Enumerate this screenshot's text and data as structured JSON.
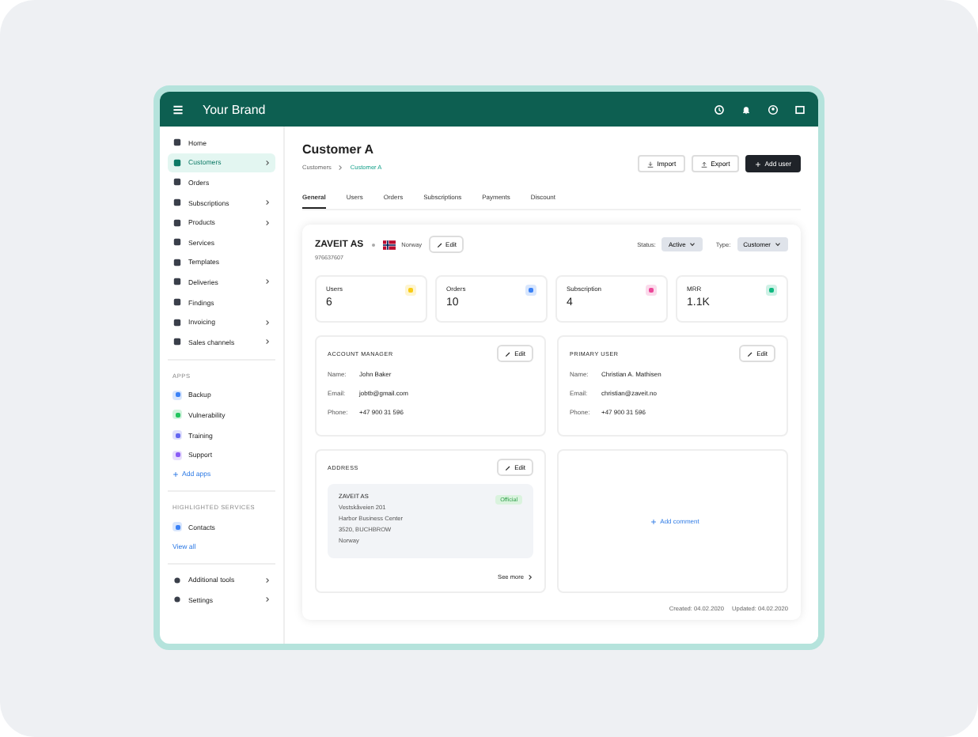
{
  "header": {
    "brand": "Your Brand"
  },
  "sidebar": {
    "items": [
      {
        "label": "Home",
        "selected": false,
        "chevron": false
      },
      {
        "label": "Customers",
        "selected": true,
        "chevron": true
      },
      {
        "label": "Orders",
        "selected": false,
        "chevron": false
      },
      {
        "label": "Subscriptions",
        "selected": false,
        "chevron": true
      },
      {
        "label": "Products",
        "selected": false,
        "chevron": true
      },
      {
        "label": "Services",
        "selected": false,
        "chevron": false
      },
      {
        "label": "Templates",
        "selected": false,
        "chevron": false
      },
      {
        "label": "Deliveries",
        "selected": false,
        "chevron": true
      },
      {
        "label": "Findings",
        "selected": false,
        "chevron": false
      },
      {
        "label": "Invoicing",
        "selected": false,
        "chevron": true
      },
      {
        "label": "Sales channels",
        "selected": false,
        "chevron": true
      }
    ],
    "apps_heading": "APPS",
    "apps": [
      {
        "label": "Backup",
        "color": "#3b82f6"
      },
      {
        "label": "Vulnerability",
        "color": "#22c55e"
      },
      {
        "label": "Training",
        "color": "#6366f1"
      },
      {
        "label": "Support",
        "color": "#8b5cf6"
      }
    ],
    "add_apps": "Add apps",
    "services_heading": "HIGHLIGHTED SERVICES",
    "services": [
      {
        "label": "Contacts",
        "color": "#3b82f6"
      }
    ],
    "view_all": "View all",
    "bottom": [
      {
        "label": "Additional tools"
      },
      {
        "label": "Settings"
      }
    ]
  },
  "page": {
    "title": "Customer A",
    "breadcrumb": [
      "Customers",
      "Customer A"
    ],
    "actions": [
      {
        "label": "Import",
        "kind": "import"
      },
      {
        "label": "Export",
        "kind": "export"
      },
      {
        "label": "Add user",
        "kind": "primary"
      }
    ],
    "tabs": [
      {
        "label": "General",
        "selected": true
      },
      {
        "label": "Users",
        "selected": false
      },
      {
        "label": "Orders",
        "selected": false
      },
      {
        "label": "Subscriptions",
        "selected": false
      },
      {
        "label": "Payments",
        "selected": false
      },
      {
        "label": "Discount",
        "selected": false
      }
    ]
  },
  "company": {
    "name": "ZAVEIT AS",
    "country": "Norway",
    "edit": "Edit",
    "org_number": "976637607",
    "status_label": "Status:",
    "status": "Active",
    "type_label": "Type:",
    "type": "Customer"
  },
  "stats": [
    {
      "label": "Users",
      "value": "6",
      "color": "#facc15"
    },
    {
      "label": "Orders",
      "value": "10",
      "color": "#3b82f6"
    },
    {
      "label": "Subscription",
      "value": "4",
      "color": "#ec4899"
    },
    {
      "label": "MRR",
      "value": "1.1K",
      "color": "#10b981"
    }
  ],
  "contacts": [
    {
      "title": "ACCOUNT MANAGER",
      "edit": "Edit",
      "fields": [
        {
          "label": "Name:",
          "value": "John Baker"
        },
        {
          "label": "Email:",
          "value": "jobtb@gmail.com"
        },
        {
          "label": "Phone:",
          "value": "+47 900 31 596"
        }
      ]
    },
    {
      "title": "PRIMARY USER",
      "edit": "Edit",
      "fields": [
        {
          "label": "Name:",
          "value": "Christian A. Mathisen"
        },
        {
          "label": "Email:",
          "value": "christian@zaveit.no"
        },
        {
          "label": "Phone:",
          "value": "+47 900 31 596"
        }
      ]
    }
  ],
  "address": {
    "title": "ADDRESS",
    "edit": "Edit",
    "badge": "Official",
    "lines": [
      "ZAVEIT AS",
      "Vestskåveien 201",
      "Harbor Business Center",
      "3520, BUCHBROW",
      "Norway"
    ],
    "see_more": "See more"
  },
  "comment": {
    "add": "Add comment"
  },
  "footer": {
    "created": "Created: 04.02.2020",
    "updated": "Updated: 04.02.2020"
  }
}
